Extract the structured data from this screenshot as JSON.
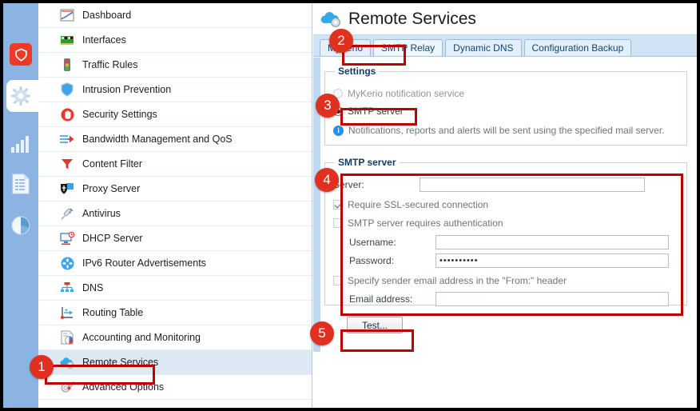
{
  "rail": {
    "items": [
      {
        "name": "shield-status",
        "icon": "shield-icon"
      },
      {
        "name": "configuration",
        "icon": "gear-icon",
        "selected": true
      },
      {
        "name": "status-statistics",
        "icon": "bar-chart-icon"
      },
      {
        "name": "logs",
        "icon": "document-list-icon"
      },
      {
        "name": "reports",
        "icon": "pie-chart-icon"
      }
    ]
  },
  "sidebar": {
    "items": [
      {
        "label": "Dashboard",
        "icon": "dashboard-chart-icon"
      },
      {
        "label": "Interfaces",
        "icon": "network-card-icon"
      },
      {
        "label": "Traffic Rules",
        "icon": "traffic-light-icon"
      },
      {
        "label": "Intrusion Prevention",
        "icon": "blue-shield-icon"
      },
      {
        "label": "Security Settings",
        "icon": "stop-hand-icon"
      },
      {
        "label": "Bandwidth Management and QoS",
        "icon": "bandwidth-arrow-icon"
      },
      {
        "label": "Content Filter",
        "icon": "funnel-icon"
      },
      {
        "label": "Proxy Server",
        "icon": "proxy-mask-icon"
      },
      {
        "label": "Antivirus",
        "icon": "syringe-icon"
      },
      {
        "label": "DHCP Server",
        "icon": "monitor-clock-icon"
      },
      {
        "label": "IPv6 Router Advertisements",
        "icon": "router-node-icon"
      },
      {
        "label": "DNS",
        "icon": "dns-tree-icon"
      },
      {
        "label": "Routing Table",
        "icon": "routing-axis-icon"
      },
      {
        "label": "Accounting and Monitoring",
        "icon": "report-pie-icon"
      },
      {
        "label": "Remote Services",
        "icon": "cloud-gear-icon",
        "selected": true
      },
      {
        "label": "Advanced Options",
        "icon": "gear-wrench-icon"
      }
    ]
  },
  "header": {
    "title": "Remote Services",
    "icon": "cloud-gear-icon"
  },
  "tabs": [
    {
      "label": "MyKerio",
      "active": false
    },
    {
      "label": "SMTP Relay",
      "active": true
    },
    {
      "label": "Dynamic DNS",
      "active": false
    },
    {
      "label": "Configuration Backup",
      "active": false
    }
  ],
  "settings_group": {
    "legend": "Settings",
    "options": [
      {
        "label": "MyKerio notification service",
        "selected": false,
        "disabled": true
      },
      {
        "label": "SMTP server",
        "selected": true,
        "disabled": false
      }
    ],
    "info_icon": "info-icon",
    "info_text": "Notifications, reports and alerts will be sent using the specified mail server."
  },
  "smtp_group": {
    "legend": "SMTP server",
    "server_label": "Server:",
    "server_value": "",
    "server_placeholder": "",
    "ssl_checkbox": {
      "label": "Require SSL-secured connection",
      "checked": true,
      "disabled": true
    },
    "auth_checkbox": {
      "label": "SMTP server requires authentication",
      "checked": false,
      "disabled": true
    },
    "username_label": "Username:",
    "username_value": "",
    "password_label": "Password:",
    "password_value": "••••••••••",
    "sender_checkbox": {
      "label": "Specify sender email address in the \"From:\" header",
      "checked": false,
      "disabled": true
    },
    "email_label": "Email address:",
    "email_value": ""
  },
  "actions": {
    "test_label": "Test..."
  },
  "annotations": {
    "badges": [
      {
        "number": "1",
        "target": "sidebar-item-remote-services"
      },
      {
        "number": "2",
        "target": "tab-smtp-relay"
      },
      {
        "number": "3",
        "target": "smtp-server-radio"
      },
      {
        "number": "4",
        "target": "smtp-server-group"
      },
      {
        "number": "5",
        "target": "test-button"
      }
    ],
    "highlight_color": "#c00000",
    "badge_color": "#e03020"
  }
}
